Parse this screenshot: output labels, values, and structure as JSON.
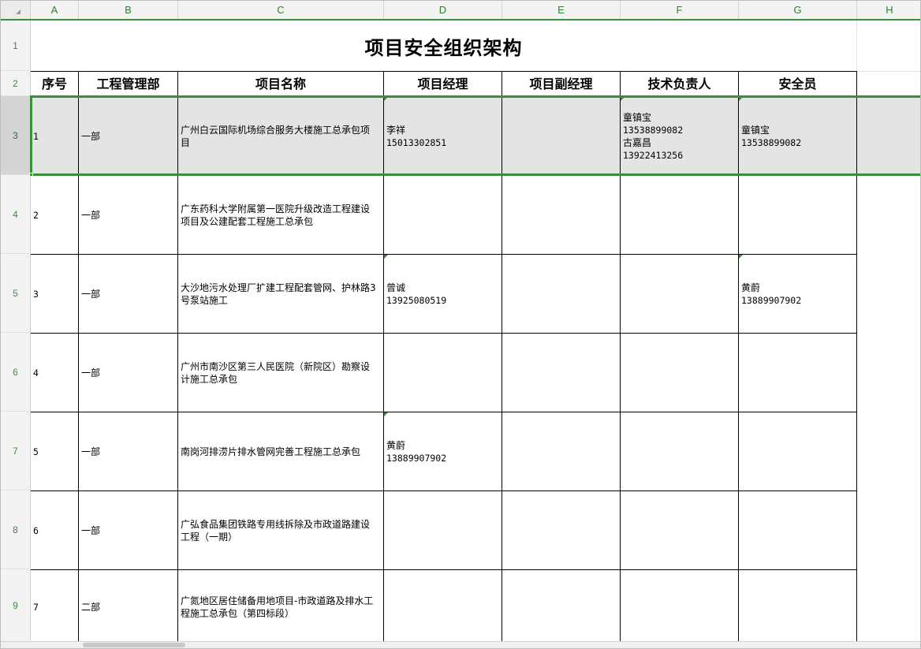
{
  "columns": [
    "A",
    "B",
    "C",
    "D",
    "E",
    "F",
    "G",
    "H"
  ],
  "rows": [
    "1",
    "2",
    "3",
    "4",
    "5",
    "6",
    "7",
    "8",
    "9"
  ],
  "sheet_title": "项目安全组织架构",
  "table_headers": [
    "序号",
    "工程管理部",
    "项目名称",
    "项目经理",
    "项目副经理",
    "技术负责人",
    "安全员"
  ],
  "table_rows": [
    {
      "seq": "1",
      "dept": "一部",
      "project": "广州白云国际机场综合服务大楼施工总承包项目",
      "manager": [
        "李祥",
        "15013302851"
      ],
      "deputy": [],
      "tech": [
        "童镇宝",
        "13538899082",
        "古嘉昌",
        "13922413256"
      ],
      "safety": [
        "童镇宝",
        "13538899082"
      ]
    },
    {
      "seq": "2",
      "dept": "一部",
      "project": "广东药科大学附属第一医院升级改造工程建设项目及公建配套工程施工总承包",
      "manager": [],
      "deputy": [],
      "tech": [],
      "safety": []
    },
    {
      "seq": "3",
      "dept": "一部",
      "project": "大沙地污水处理厂扩建工程配套管网、护林路3号泵站施工",
      "manager": [
        "曾诚",
        "13925080519"
      ],
      "deputy": [],
      "tech": [],
      "safety": [
        "黄蔚",
        "13889907902"
      ]
    },
    {
      "seq": "4",
      "dept": "一部",
      "project": "广州市南沙区第三人民医院（新院区）勘察设计施工总承包",
      "manager": [],
      "deputy": [],
      "tech": [],
      "safety": []
    },
    {
      "seq": "5",
      "dept": "一部",
      "project": "南岗河排涝片排水管网完善工程施工总承包",
      "manager": [
        "黄蔚",
        "13889907902"
      ],
      "deputy": [],
      "tech": [],
      "safety": []
    },
    {
      "seq": "6",
      "dept": "一部",
      "project": "广弘食品集团铁路专用线拆除及市政道路建设工程（一期）",
      "manager": [],
      "deputy": [],
      "tech": [],
      "safety": []
    },
    {
      "seq": "7",
      "dept": "二部",
      "project": "广氮地区居住储备用地项目-市政道路及排水工程施工总承包（第四标段）",
      "manager": [],
      "deputy": [],
      "tech": [],
      "safety": []
    }
  ],
  "colors": {
    "accent": "#3a8f3a",
    "selected_row": "#e4e4e4"
  }
}
